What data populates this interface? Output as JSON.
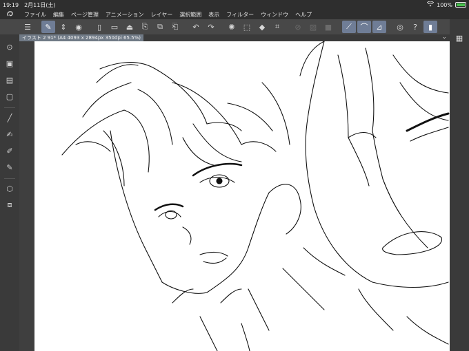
{
  "status": {
    "time": "19:19",
    "date": "2月11日(土)",
    "battery": "100%",
    "wifi_icon": "wifi-icon",
    "battery_icon": "battery-charging-icon"
  },
  "menubar": {
    "logo_icon": "clip-studio-logo-icon",
    "items": [
      "ファイル",
      "編集",
      "ページ管理",
      "アニメーション",
      "レイヤー",
      "選択範囲",
      "表示",
      "フィルター",
      "ウィンドウ",
      "ヘルプ"
    ]
  },
  "toolbar": {
    "buttons": [
      {
        "icon": "menu-icon",
        "glyph": "☰",
        "active": false
      },
      {
        "icon": "pen-settings-icon",
        "glyph": "✎",
        "active": true
      },
      {
        "icon": "up-down-arrows-icon",
        "glyph": "⇕",
        "active": false
      },
      {
        "icon": "record-icon",
        "glyph": "◉",
        "active": false
      },
      {
        "icon": "new-file-icon",
        "glyph": "▯",
        "active": false
      },
      {
        "icon": "open-folder-icon",
        "glyph": "▭",
        "active": false
      },
      {
        "icon": "save-icon",
        "glyph": "⏏",
        "active": false
      },
      {
        "icon": "export-icon",
        "glyph": "⎘",
        "active": false
      },
      {
        "icon": "copy-icon",
        "glyph": "⧉",
        "active": false
      },
      {
        "icon": "paste-icon",
        "glyph": "⎗",
        "active": false
      },
      {
        "icon": "undo-icon",
        "glyph": "↶",
        "active": false
      },
      {
        "icon": "redo-icon",
        "glyph": "↷",
        "active": false
      },
      {
        "icon": "loading-icon",
        "glyph": "✺",
        "active": false
      },
      {
        "icon": "clear-selection-icon",
        "glyph": "⬚",
        "active": false
      },
      {
        "icon": "fill-icon",
        "glyph": "◆",
        "active": false
      },
      {
        "icon": "crop-icon",
        "glyph": "⌗",
        "active": false
      },
      {
        "icon": "ruler-off-icon",
        "glyph": "⊘",
        "active": false
      },
      {
        "icon": "ruler-icon",
        "glyph": "▨",
        "active": false
      },
      {
        "icon": "snap-icon",
        "glyph": "■",
        "active": false
      },
      {
        "icon": "snap-ruler-icon",
        "glyph": "⟋",
        "active": true
      },
      {
        "icon": "snap-special-ruler-icon",
        "glyph": "⌒",
        "active": true
      },
      {
        "icon": "snap-grid-icon",
        "glyph": "⊿",
        "active": true
      },
      {
        "icon": "account-icon",
        "glyph": "◎",
        "active": false
      },
      {
        "icon": "help-icon",
        "glyph": "?",
        "active": false
      },
      {
        "icon": "smartphone-icon",
        "glyph": "▮",
        "active": true
      }
    ]
  },
  "tab": {
    "title": "イラスト 2 91* (A4 4093 x 2894px 350dpi 65.5%)",
    "chevron_icon": "chevron-down-icon"
  },
  "lefttools": [
    {
      "icon": "shield-tool-icon",
      "glyph": "⛉"
    },
    {
      "icon": "zoom-tool-icon",
      "glyph": "⊙"
    },
    {
      "icon": "layer-tool-icon",
      "glyph": "▣"
    },
    {
      "icon": "eyedropper-tool-icon",
      "glyph": "▤"
    },
    {
      "icon": "rectangle-tool-icon",
      "glyph": "▢"
    },
    {
      "icon": "pen-tool-icon",
      "glyph": "╱"
    },
    {
      "icon": "brush-tool-icon",
      "glyph": "✍"
    },
    {
      "icon": "eraser-tool-icon",
      "glyph": "✐"
    },
    {
      "icon": "fill-tool-icon",
      "glyph": "✎"
    },
    {
      "icon": "gradient-tool-icon",
      "glyph": "⬡"
    },
    {
      "icon": "layers-icon",
      "glyph": "⧈"
    }
  ],
  "rightpanel": {
    "icon": "panel-toggle-icon",
    "glyph": "▦"
  }
}
